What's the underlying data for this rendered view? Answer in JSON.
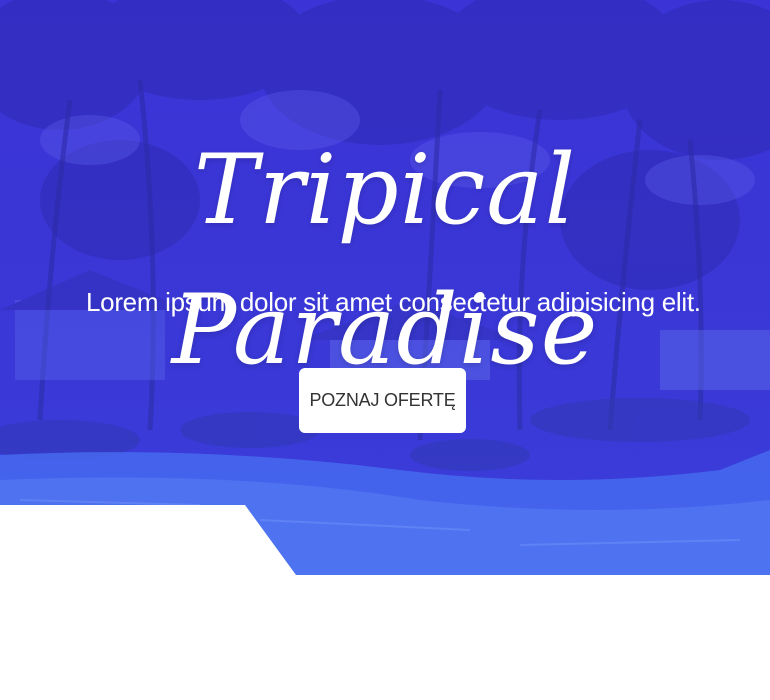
{
  "hero": {
    "title": "Tripical Paradise",
    "subtitle": "Lorem ipsum dolor sit amet consectetur adipisicing elit.",
    "cta_label": "POZNAJ OFERTĘ",
    "overlay_color": "#3b3fe0",
    "button_color": "#ffffff"
  }
}
